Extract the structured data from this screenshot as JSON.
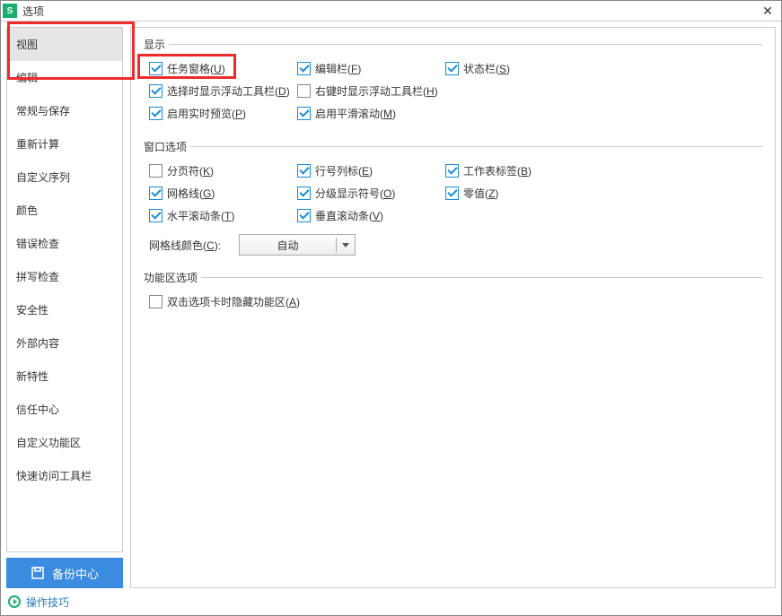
{
  "title": "选项",
  "sidebar": {
    "items": [
      {
        "label": "视图",
        "selected": true
      },
      {
        "label": "编辑"
      },
      {
        "label": "常规与保存"
      },
      {
        "label": "重新计算"
      },
      {
        "label": "自定义序列"
      },
      {
        "label": "颜色"
      },
      {
        "label": "错误检查"
      },
      {
        "label": "拼写检查"
      },
      {
        "label": "安全性"
      },
      {
        "label": "外部内容"
      },
      {
        "label": "新特性"
      },
      {
        "label": "信任中心"
      },
      {
        "label": "自定义功能区"
      },
      {
        "label": "快速访问工具栏"
      }
    ],
    "backup_label": "备份中心"
  },
  "groups": {
    "display": {
      "title": "显示",
      "opts": {
        "task_pane": {
          "text": "任务窗格",
          "key": "U",
          "checked": true
        },
        "edit_bar": {
          "text": "编辑栏",
          "key": "F",
          "checked": true
        },
        "status_bar": {
          "text": "状态栏",
          "key": "S",
          "checked": true
        },
        "sel_float": {
          "text": "选择时显示浮动工具栏",
          "key": "D",
          "checked": true
        },
        "rclick_float": {
          "text": "右键时显示浮动工具栏",
          "key": "H",
          "checked": false
        },
        "live_preview": {
          "text": "启用实时预览",
          "key": "P",
          "checked": true
        },
        "smooth_scroll": {
          "text": "启用平滑滚动",
          "key": "M",
          "checked": true
        }
      }
    },
    "window": {
      "title": "窗口选项",
      "opts": {
        "page_break": {
          "text": "分页符",
          "key": "K",
          "checked": false
        },
        "row_col_hdr": {
          "text": "行号列标",
          "key": "E",
          "checked": true
        },
        "sheet_tabs": {
          "text": "工作表标签",
          "key": "B",
          "checked": true
        },
        "gridlines": {
          "text": "网格线",
          "key": "G",
          "checked": true
        },
        "outline_sym": {
          "text": "分级显示符号",
          "key": "O",
          "checked": true
        },
        "zero_values": {
          "text": "零值",
          "key": "Z",
          "checked": true
        },
        "hscroll": {
          "text": "水平滚动条",
          "key": "T",
          "checked": true
        },
        "vscroll": {
          "text": "垂直滚动条",
          "key": "V",
          "checked": true
        }
      },
      "grid_color_label": {
        "text": "网格线颜色",
        "key": "C"
      },
      "grid_color_value": "自动"
    },
    "ribbon": {
      "title": "功能区选项",
      "opts": {
        "dbl_hide": {
          "text": "双击选项卡时隐藏功能区",
          "key": "A",
          "checked": false
        }
      }
    }
  },
  "footer": {
    "tip_label": "操作技巧"
  }
}
